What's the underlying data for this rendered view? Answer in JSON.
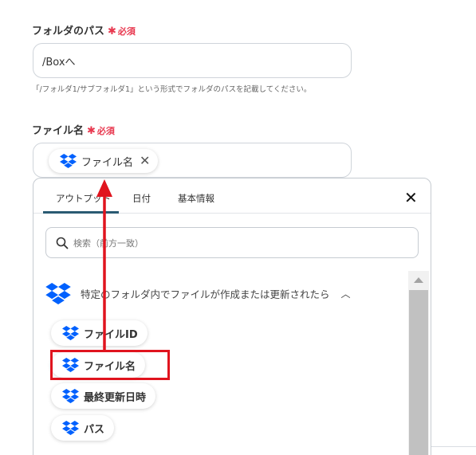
{
  "folder_path": {
    "label": "フォルダのパス",
    "required_star": "✱",
    "required_text": "必須",
    "value": "/Boxへ",
    "help": "「/フォルダ1/サブフォルダ1」という形式でフォルダのパスを記載してください。"
  },
  "file_name": {
    "label": "ファイル名",
    "required_star": "✱",
    "required_text": "必須",
    "chip_label": "ファイル名",
    "chip_icon": "dropbox-icon",
    "chip_remove": "✕"
  },
  "picker": {
    "tabs": [
      {
        "label": "アウトプット",
        "active": true
      },
      {
        "label": "日付",
        "active": false
      },
      {
        "label": "基本情報",
        "active": false
      }
    ],
    "close_label": "✕",
    "search_placeholder": "検索（前方一致）",
    "trigger_label": "特定のフォルダ内でファイルが作成または更新されたら",
    "trigger_toggle": "︿",
    "outputs": [
      {
        "label": "ファイルID",
        "highlighted": false
      },
      {
        "label": "ファイル名",
        "highlighted": true
      },
      {
        "label": "最終更新日時",
        "highlighted": false
      },
      {
        "label": "パス",
        "highlighted": false
      }
    ]
  },
  "colors": {
    "required": "#e8384f",
    "dropbox": "#0061fe",
    "highlight": "#e0141e",
    "active_tab": "#2a5a73"
  }
}
